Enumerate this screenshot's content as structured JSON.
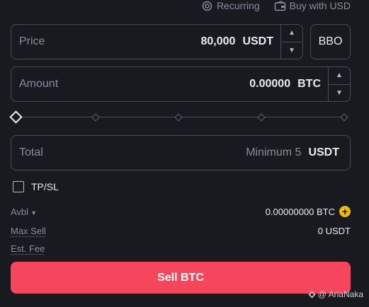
{
  "top_links": {
    "recurring_label": "Recurring",
    "buy_with_label": "Buy with USD"
  },
  "price": {
    "label": "Price",
    "value": "80,000",
    "unit": "USDT"
  },
  "bbo_label": "BBO",
  "amount": {
    "label": "Amount",
    "value": "0.00000",
    "unit": "BTC"
  },
  "slider": {
    "value_fraction": 0,
    "ticks": [
      0.25,
      0.5,
      0.75,
      1.0
    ]
  },
  "total": {
    "label": "Total",
    "placeholder": "Minimum 5",
    "unit": "USDT"
  },
  "tpsl_label": "TP/SL",
  "avbl": {
    "label": "Avbl",
    "value": "0.00000000 BTC"
  },
  "max_sell": {
    "label": "Max Sell",
    "value": "0 USDT"
  },
  "est_fee": {
    "label": "Est. Fee"
  },
  "sell_button_label": "Sell BTC",
  "watermark_text": "@ AriaNaka",
  "colors": {
    "background": "#181a20",
    "border": "#474d57",
    "sell": "#f6465d",
    "accent": "#f0b90b",
    "muted": "#848e9c"
  }
}
